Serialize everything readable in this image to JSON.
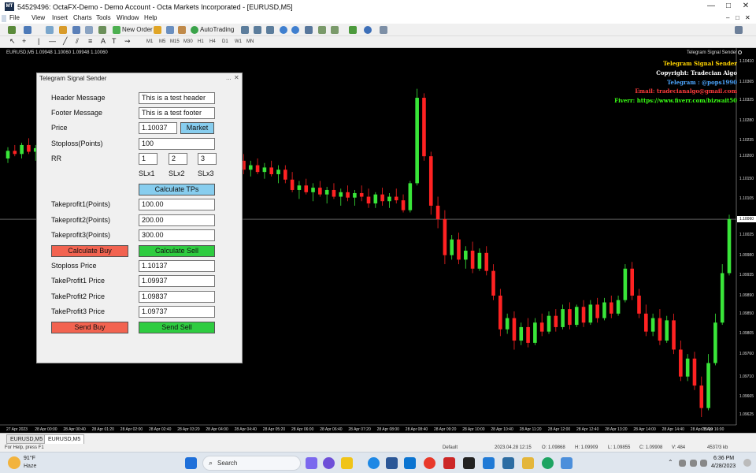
{
  "window": {
    "title": "54529496: OctaFX-Demo - Demo Account - Octa Markets Incorporated - [EURUSD,M5]",
    "app_icon": "mt4-icon",
    "controls": [
      "—",
      "□",
      "✕"
    ],
    "inner_controls": [
      "–",
      "□",
      "✕"
    ]
  },
  "menu": [
    "File",
    "View",
    "Insert",
    "Charts",
    "Tools",
    "Window",
    "Help"
  ],
  "toolbar": {
    "new_order": "New Order",
    "autotrading": "AutoTrading",
    "timeframes": [
      "M1",
      "M5",
      "M15",
      "M30",
      "H1",
      "H4",
      "D1",
      "W1",
      "MN"
    ]
  },
  "chart": {
    "symbol_label": "EURUSD,M5  1.09948 1.10060 1.09948 1.10060",
    "indicator_name": "Telegram Signal Sender",
    "overlay": [
      {
        "text": "Telegram Signal Sender",
        "color": "#ffd400"
      },
      {
        "text": "Copyright: Tradecian Algo",
        "color": "#ffffff"
      },
      {
        "text": "Telegram : @pops1990",
        "color": "#4da6ff"
      },
      {
        "text": "Email: tradecianalgo@gmail.com",
        "color": "#ff3b3b"
      },
      {
        "text": "Fiverr: https://www.fiverr.com/bizwait50",
        "color": "#39ff14"
      }
    ],
    "current_price": "1.10060",
    "price_ticks": [
      "1.10410",
      "1.10365",
      "1.10325",
      "1.10280",
      "1.10235",
      "1.10200",
      "1.10150",
      "1.10105",
      "1.10060",
      "1.10025",
      "1.09980",
      "1.09935",
      "1.09890",
      "1.09850",
      "1.09805",
      "1.09760",
      "1.09710",
      "1.09665",
      "1.09625"
    ],
    "time_ticks": [
      "27 Apr 2023",
      "28 Apr 00:00",
      "28 Apr 00:40",
      "28 Apr 01:20",
      "28 Apr 02:00",
      "28 Apr 02:40",
      "28 Apr 03:20",
      "28 Apr 04:00",
      "28 Apr 04:40",
      "28 Apr 05:20",
      "28 Apr 06:00",
      "28 Apr 06:40",
      "28 Apr 07:20",
      "28 Apr 08:00",
      "28 Apr 08:40",
      "28 Apr 09:20",
      "28 Apr 10:00",
      "28 Apr 10:40",
      "28 Apr 11:20",
      "28 Apr 12:00",
      "28 Apr 12:40",
      "28 Apr 13:20",
      "28 Apr 14:00",
      "28 Apr 14:40",
      "28 Apr 15:20",
      "28 Apr 16:00"
    ],
    "candles": [
      [
        1.10195,
        1.1022,
        1.10185,
        1.10212
      ],
      [
        1.10212,
        1.10225,
        1.102,
        1.10205
      ],
      [
        1.10205,
        1.1023,
        1.10195,
        1.10225
      ],
      [
        1.10225,
        1.1024,
        1.10205,
        1.1021
      ],
      [
        1.1021,
        1.10225,
        1.1019,
        1.10218
      ],
      [
        1.10218,
        1.10232,
        1.102,
        1.10208
      ],
      [
        1.10208,
        1.10222,
        1.10195,
        1.10215
      ],
      [
        1.10215,
        1.10228,
        1.102,
        1.10202
      ],
      [
        1.10202,
        1.1022,
        1.1019,
        1.10212
      ],
      [
        1.10212,
        1.10225,
        1.10198,
        1.10205
      ],
      [
        1.10205,
        1.10222,
        1.10195,
        1.10215
      ],
      [
        1.10215,
        1.1023,
        1.10205,
        1.10208
      ],
      [
        1.10208,
        1.10225,
        1.10195,
        1.10218
      ],
      [
        1.10218,
        1.10232,
        1.10205,
        1.1021
      ],
      [
        1.1021,
        1.10228,
        1.102,
        1.1022
      ],
      [
        1.1022,
        1.10235,
        1.10205,
        1.10212
      ],
      [
        1.10212,
        1.10225,
        1.10195,
        1.10205
      ],
      [
        1.10205,
        1.10222,
        1.10195,
        1.10216
      ],
      [
        1.10216,
        1.1023,
        1.102,
        1.10208
      ],
      [
        1.10208,
        1.10225,
        1.10195,
        1.10218
      ],
      [
        1.10218,
        1.10232,
        1.10205,
        1.1021
      ],
      [
        1.1021,
        1.10228,
        1.10195,
        1.10215
      ],
      [
        1.10215,
        1.10228,
        1.102,
        1.10205
      ],
      [
        1.10205,
        1.10222,
        1.1019,
        1.10212
      ],
      [
        1.10212,
        1.10225,
        1.10195,
        1.10202
      ],
      [
        1.10202,
        1.1022,
        1.1019,
        1.10214
      ],
      [
        1.10214,
        1.10228,
        1.102,
        1.10206
      ],
      [
        1.10206,
        1.10222,
        1.10195,
        1.10216
      ],
      [
        1.10216,
        1.1023,
        1.102,
        1.10208
      ],
      [
        1.10208,
        1.10225,
        1.10195,
        1.10218
      ],
      [
        1.10218,
        1.10235,
        1.10205,
        1.10228
      ],
      [
        1.10228,
        1.1025,
        1.10215,
        1.1024
      ],
      [
        1.1024,
        1.10255,
        1.10205,
        1.1021
      ],
      [
        1.1021,
        1.10225,
        1.10185,
        1.1019
      ],
      [
        1.1019,
        1.10205,
        1.1016,
        1.1017
      ],
      [
        1.1017,
        1.1019,
        1.10155,
        1.1018
      ],
      [
        1.1018,
        1.10195,
        1.1016,
        1.10165
      ],
      [
        1.10165,
        1.10185,
        1.1015,
        1.10175
      ],
      [
        1.10175,
        1.1019,
        1.10155,
        1.1016
      ],
      [
        1.1016,
        1.1018,
        1.1014,
        1.1017
      ],
      [
        1.1017,
        1.1018,
        1.1014,
        1.10148
      ],
      [
        1.10148,
        1.10165,
        1.1012,
        1.10125
      ],
      [
        1.10125,
        1.10145,
        1.10105,
        1.10135
      ],
      [
        1.10135,
        1.1015,
        1.10115,
        1.1012
      ],
      [
        1.1012,
        1.1014,
        1.101,
        1.1013
      ],
      [
        1.1013,
        1.10145,
        1.1011,
        1.10115
      ],
      [
        1.10115,
        1.10132,
        1.10095,
        1.10125
      ],
      [
        1.10125,
        1.1014,
        1.10105,
        1.1011
      ],
      [
        1.1011,
        1.10128,
        1.1009,
        1.1012
      ],
      [
        1.1012,
        1.10135,
        1.101,
        1.10108
      ],
      [
        1.10108,
        1.10125,
        1.1009,
        1.10118
      ],
      [
        1.10118,
        1.10135,
        1.101,
        1.1011
      ],
      [
        1.1011,
        1.10128,
        1.10085,
        1.10095
      ],
      [
        1.10095,
        1.1012,
        1.10085,
        1.10115
      ],
      [
        1.10115,
        1.1013,
        1.1009,
        1.101
      ],
      [
        1.101,
        1.10118,
        1.10085,
        1.1011
      ],
      [
        1.1011,
        1.10128,
        1.10095,
        1.10102
      ],
      [
        1.10102,
        1.10115,
        1.10075,
        1.1008
      ],
      [
        1.1008,
        1.10145,
        1.10075,
        1.1014
      ],
      [
        1.1014,
        1.1035,
        1.10135,
        1.1033
      ],
      [
        1.1033,
        1.1034,
        1.1019,
        1.102
      ],
      [
        1.102,
        1.1021,
        1.1007,
        1.1009
      ],
      [
        1.1009,
        1.1011,
        1.1004,
        1.1006
      ],
      [
        1.1006,
        1.1008,
        1.0996,
        1.0998
      ],
      [
        1.0998,
        1.10025,
        1.0997,
        1.10015
      ],
      [
        1.10015,
        1.1003,
        1.0996,
        1.0997
      ],
      [
        1.0997,
        1.1,
        1.0995,
        1.0999
      ],
      [
        1.0999,
        1.1001,
        1.0994,
        1.0995
      ],
      [
        1.0995,
        1.09995,
        1.09945,
        1.09985
      ],
      [
        1.09985,
        1.1,
        1.09935,
        1.09945
      ],
      [
        1.09945,
        1.0996,
        1.0988,
        1.0989
      ],
      [
        1.0989,
        1.09905,
        1.098,
        1.09815
      ],
      [
        1.09815,
        1.0985,
        1.09805,
        1.0984
      ],
      [
        1.0984,
        1.09855,
        1.0977,
        1.0979
      ],
      [
        1.0979,
        1.0983,
        1.0978,
        1.0982
      ],
      [
        1.0982,
        1.0984,
        1.09775,
        1.09785
      ],
      [
        1.09785,
        1.0984,
        1.0978,
        1.0983
      ],
      [
        1.0983,
        1.0985,
        1.098,
        1.0981
      ],
      [
        1.0981,
        1.09855,
        1.09805,
        1.09845
      ],
      [
        1.09845,
        1.0986,
        1.0981,
        1.0982
      ],
      [
        1.0982,
        1.0987,
        1.09815,
        1.0986
      ],
      [
        1.0986,
        1.09875,
        1.09815,
        1.09825
      ],
      [
        1.09825,
        1.0987,
        1.0982,
        1.09865
      ],
      [
        1.09865,
        1.0988,
        1.0982,
        1.0983
      ],
      [
        1.0983,
        1.0988,
        1.09825,
        1.0987
      ],
      [
        1.0987,
        1.09885,
        1.0983,
        1.0984
      ],
      [
        1.0984,
        1.09885,
        1.09835,
        1.09875
      ],
      [
        1.09875,
        1.0989,
        1.0984,
        1.0985
      ],
      [
        1.0985,
        1.0989,
        1.09845,
        1.0988
      ],
      [
        1.0988,
        1.0996,
        1.09875,
        1.0995
      ],
      [
        1.0995,
        1.09965,
        1.0988,
        1.0989
      ],
      [
        1.0989,
        1.09905,
        1.0984,
        1.0985
      ],
      [
        1.0985,
        1.0987,
        1.098,
        1.0981
      ],
      [
        1.0981,
        1.0985,
        1.098,
        1.0984
      ],
      [
        1.0984,
        1.0986,
        1.0978,
        1.0979
      ],
      [
        1.0979,
        1.09845,
        1.09785,
        1.09835
      ],
      [
        1.09835,
        1.0985,
        1.0976,
        1.0977
      ],
      [
        1.0977,
        1.0979,
        1.097,
        1.0971
      ],
      [
        1.0971,
        1.0976,
        1.097,
        1.0975
      ],
      [
        1.0975,
        1.09765,
        1.0968,
        1.0969
      ],
      [
        1.0969,
        1.0971,
        1.0962,
        1.0964
      ],
      [
        1.0964,
        1.0976,
        1.09635,
        1.0974
      ],
      [
        1.0974,
        1.0985,
        1.09735,
        1.0983
      ],
      [
        1.0983,
        1.0996,
        1.09825,
        1.0994
      ],
      [
        1.0994,
        1.1007,
        1.09935,
        1.1006
      ]
    ]
  },
  "dialog": {
    "title": "Telegram Signal Sender",
    "controls": [
      "...",
      "✕"
    ],
    "header_label": "Header Message",
    "header_value": "This is a test header",
    "footer_label": "Footer Message",
    "footer_value": "This is a test footer",
    "price_label": "Price",
    "price_value": "1.10037",
    "market_button": "Market",
    "stoploss_label": "Stoploss(Points)",
    "stoploss_value": "100",
    "rr_label": "RR",
    "rr_values": [
      "1",
      "2",
      "3"
    ],
    "rr_captions": [
      "SLx1",
      "SLx2",
      "SLx3"
    ],
    "calc_tps_button": "Calculate TPs",
    "tp1_label": "Takeprofit1(Points)",
    "tp1_value": "100.00",
    "tp2_label": "Takeprofit2(Points)",
    "tp2_value": "200.00",
    "tp3_label": "Takeprofit3(Points)",
    "tp3_value": "300.00",
    "calc_buy_button": "Calculate Buy",
    "calc_sell_button": "Calculate Sell",
    "sl_price_label": "Stoploss Price",
    "sl_price_value": "1.10137",
    "tp1_price_label": "TakeProfit1 Price",
    "tp1_price_value": "1.09937",
    "tp2_price_label": "TakeProfit2 Price",
    "tp2_price_value": "1.09837",
    "tp3_price_label": "TakeProfit3 Price",
    "tp3_price_value": "1.09737",
    "send_buy_button": "Send Buy",
    "send_sell_button": "Send Sell"
  },
  "tabs": [
    "EURUSD,M5",
    "EURUSD,M5"
  ],
  "status": {
    "help": "For Help, press F1",
    "profile": "Default",
    "bar_time": "2023.04.28 12:15",
    "o": "O: 1.09868",
    "h": "H: 1.09909",
    "l": "L: 1.09855",
    "c": "C: 1.09908",
    "v": "V: 484",
    "conn": "4537/3 kb"
  },
  "taskbar": {
    "weather_temp": "91°F",
    "weather_desc": "Haze",
    "search_placeholder": "Search",
    "time": "6:36 PM",
    "date": "4/28/2023"
  },
  "colors": {
    "bull": "#39e639",
    "bear": "#ff2222",
    "chart_bg": "#000000"
  }
}
